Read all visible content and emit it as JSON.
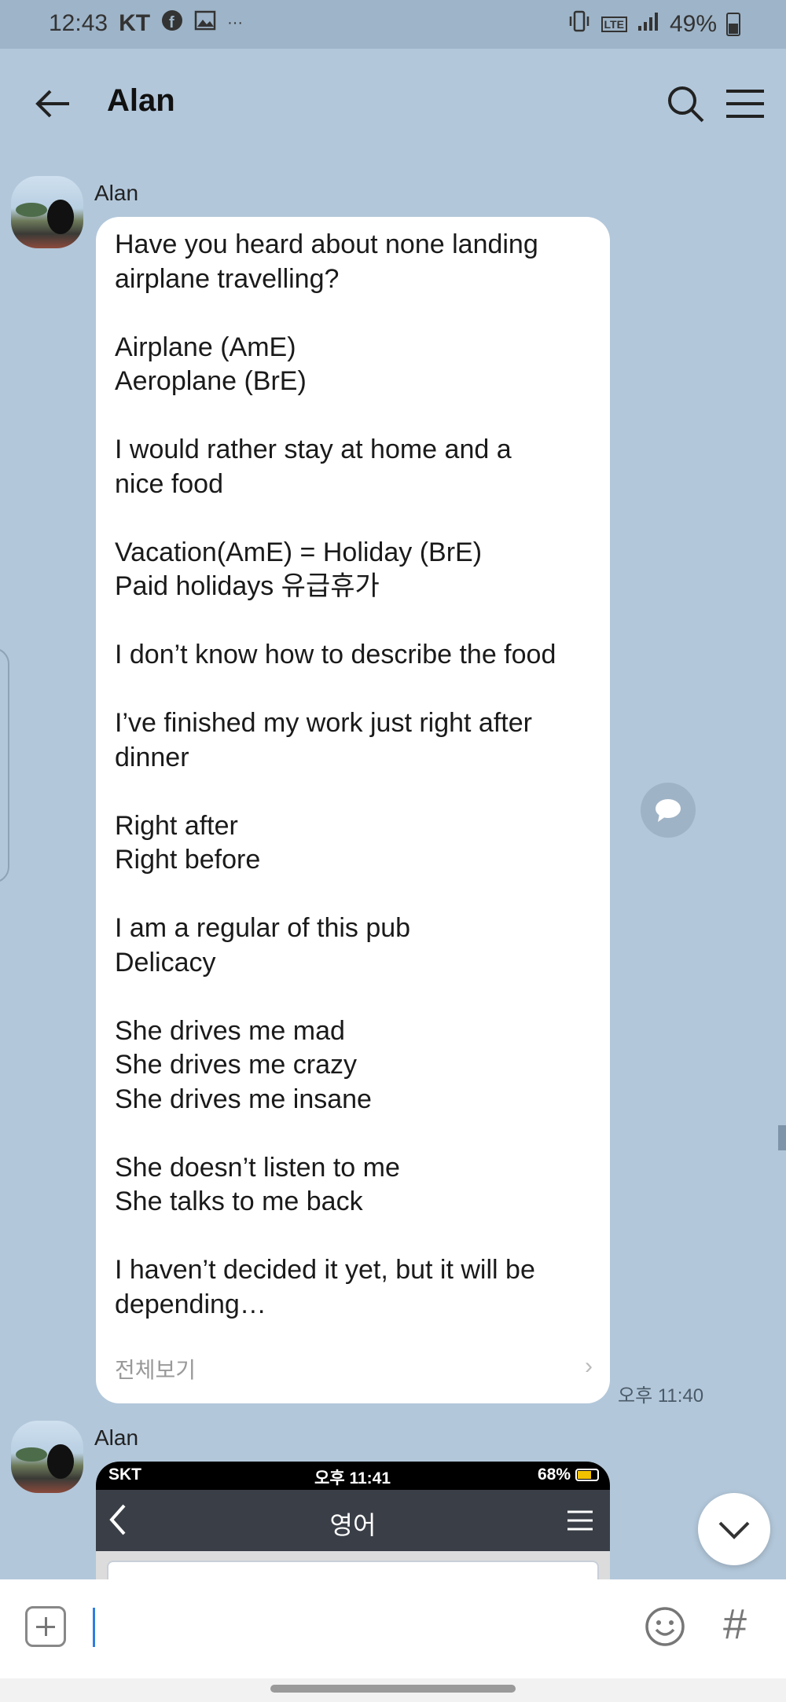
{
  "status_bar": {
    "time": "12:43",
    "carrier": "KT",
    "network": "LTE",
    "battery": "49%",
    "more": "···"
  },
  "header": {
    "title": "Alan"
  },
  "messages": [
    {
      "sender": "Alan",
      "lines": [
        "Have you heard about none landing",
        "airplane travelling?",
        "",
        "Airplane (AmE)",
        "Aeroplane (BrE)",
        "",
        "I would rather stay at home and a",
        "nice food",
        "",
        "Vacation(AmE) = Holiday (BrE)",
        "Paid holidays 유급휴가",
        "",
        "I don’t know how to describe the food",
        "",
        "I’ve finished my work just right after",
        "dinner",
        "",
        "Right after",
        "Right before",
        "",
        "I am a regular of this pub",
        "Delicacy",
        "",
        "She drives me mad",
        "She drives me crazy",
        "She drives me insane",
        "",
        "She doesn’t listen to me",
        "She talks to me back",
        "",
        "I haven’t decided it yet, but it will be",
        "depending…"
      ],
      "view_all": "전체보기",
      "time": "오후 11:40"
    },
    {
      "sender": "Alan",
      "image": {
        "status_left": "SKT",
        "status_time": "오후 11:41",
        "status_battery": "68%",
        "battery_level": 0.68,
        "app_title": "영어"
      }
    }
  ],
  "colors": {
    "chat_background": "#b2c7da",
    "bubble": "#ffffff",
    "cursor": "#2f7de1"
  },
  "icons": [
    "facebook-icon",
    "gallery-icon",
    "vibrate-icon",
    "signal-icon",
    "battery-icon",
    "back-arrow-icon",
    "search-icon",
    "menu-icon",
    "reply-icon",
    "chevron-down-icon",
    "plus-icon",
    "emoji-icon",
    "hashtag-icon"
  ]
}
